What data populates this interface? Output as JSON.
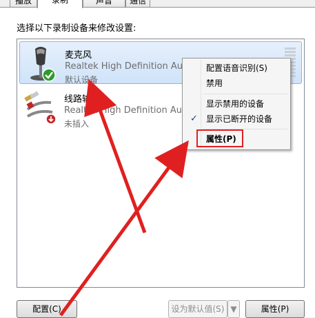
{
  "tabs": [
    {
      "label": "播放"
    },
    {
      "label": "录制"
    },
    {
      "label": "声音"
    },
    {
      "label": "通信"
    }
  ],
  "instruction": "选择以下录制设备来修改设置:",
  "devices": [
    {
      "name": "麦克风",
      "driver": "Realtek High Definition Audio",
      "status": "默认设备",
      "icon": "microphone-icon",
      "badge": "default-check-icon"
    },
    {
      "name": "线路输入",
      "driver": "Realtek High Definition Audio",
      "status": "未插入",
      "icon": "rca-cable-icon",
      "badge": "unplugged-icon"
    }
  ],
  "context_menu": {
    "items": [
      {
        "label": "配置语音识别(S)"
      },
      {
        "label": "禁用"
      },
      {
        "label": "显示禁用的设备"
      },
      {
        "label": "显示已断开的设备",
        "checked": true
      },
      {
        "label": "属性(P)",
        "bold": true
      }
    ]
  },
  "buttons": {
    "configure": "配置(C)",
    "set_default": "设为默认值(S)",
    "properties": "属性(P)"
  },
  "colors": {
    "annotation_red": "#e02020",
    "selection": "#cfe3fa"
  }
}
